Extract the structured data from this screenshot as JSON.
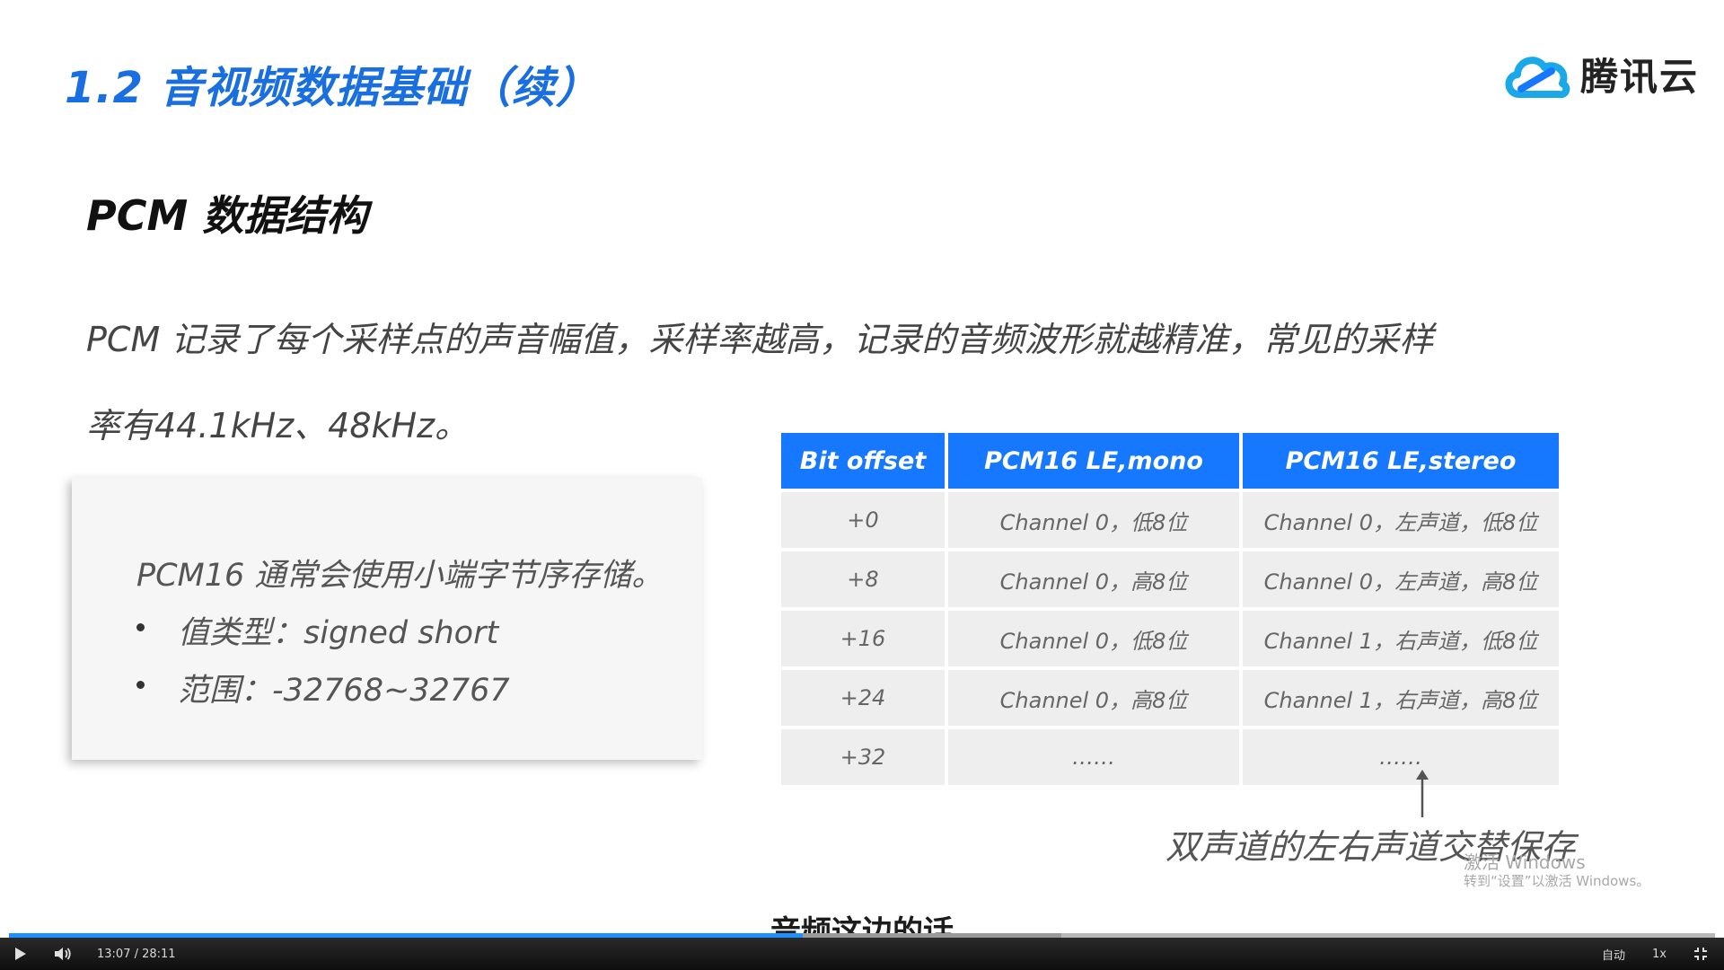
{
  "slide": {
    "title": "1.2 音视频数据基础（续）",
    "brand": "腾讯云",
    "heading": "PCM 数据结构",
    "paragraph_line1": "PCM 记录了每个采样点的声音幅值，采样率越高，记录的音频波形就越精准，常见的采样",
    "paragraph_line2": "率有44.1kHz、48kHz。",
    "info_box": {
      "head": "PCM16 通常会使用小端字节序存储。",
      "items": [
        "值类型：signed short",
        "范围：-32768~32767"
      ]
    },
    "table": {
      "headers": [
        "Bit offset",
        "PCM16 LE,mono",
        "PCM16 LE,stereo"
      ],
      "rows": [
        [
          "+0",
          "Channel 0，低8位",
          "Channel 0，左声道，低8位"
        ],
        [
          "+8",
          "Channel 0，高8位",
          "Channel 0，左声道，高8位"
        ],
        [
          "+16",
          "Channel 0，低8位",
          "Channel 1，右声道，低8位"
        ],
        [
          "+24",
          "Channel 0，高8位",
          "Channel 1，右声道，高8位"
        ],
        [
          "+32",
          "……",
          "……"
        ]
      ]
    },
    "note": "双声道的左右声道交替保存"
  },
  "watermark": {
    "title": "激活 Windows",
    "sub": "转到“设置”以激活 Windows。"
  },
  "subtitle": "音频这边的话",
  "player": {
    "time": "13:07 / 28:11",
    "progress_fraction": 0.465,
    "buffered_fraction": 0.617,
    "quality": "自动",
    "speed": "1x",
    "accent_color": "#1e90ff",
    "icons": [
      "play-icon",
      "volume-icon",
      "fullscreen-exit-icon"
    ]
  },
  "colors": {
    "title": "#1a6fe0",
    "table_header": "#1677ff",
    "table_cell": "#eeeeee"
  }
}
